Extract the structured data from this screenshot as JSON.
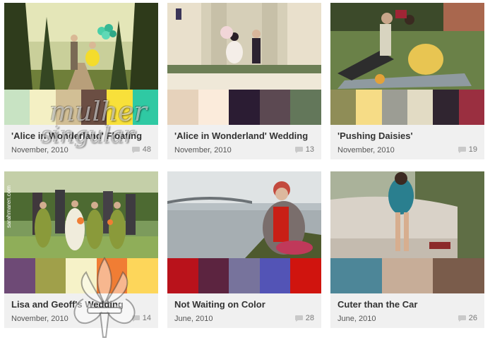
{
  "watermark": {
    "line1": "mulher",
    "line2": "singular"
  },
  "photo_credits": {
    "card4": "sarahmaren.com"
  },
  "icons": {
    "comment": "speech-bubble-icon",
    "watermark_logo": "fleur-de-lis-icon"
  },
  "cards": [
    {
      "title": "'Alice in Wonderland' Floating",
      "date": "November, 2010",
      "comments": "48",
      "palette": [
        "#c8e3c3",
        "#f4f0c4",
        "#d2bf95",
        "#6b4e43",
        "#f8e03a",
        "#2fc9a3"
      ]
    },
    {
      "title": "'Alice in Wonderland' Wedding",
      "date": "November, 2010",
      "comments": "13",
      "palette": [
        "#e6d2bb",
        "#fbebdb",
        "#2b1c33",
        "#5c4952",
        "#63775a"
      ]
    },
    {
      "title": "'Pushing Daisies'",
      "date": "November, 2010",
      "comments": "19",
      "palette": [
        "#8f8d57",
        "#f6dc86",
        "#9c9d94",
        "#e2dbc4",
        "#302530",
        "#9a2f40"
      ]
    },
    {
      "title": "Lisa and Geoff's Wedding",
      "date": "November, 2010",
      "comments": "14",
      "palette": [
        "#6e4a76",
        "#a0a04a",
        "#f6f2c8",
        "#f07d34",
        "#fdd65a"
      ]
    },
    {
      "title": "Not Waiting on Color",
      "date": "June, 2010",
      "comments": "28",
      "palette": [
        "#b9121b",
        "#5c2440",
        "#77739c",
        "#5354b6",
        "#d0140e"
      ]
    },
    {
      "title": "Cuter than the Car",
      "date": "June, 2010",
      "comments": "26",
      "palette": [
        "#4d8698",
        "#c7ad98",
        "#7a5c4b"
      ]
    }
  ]
}
